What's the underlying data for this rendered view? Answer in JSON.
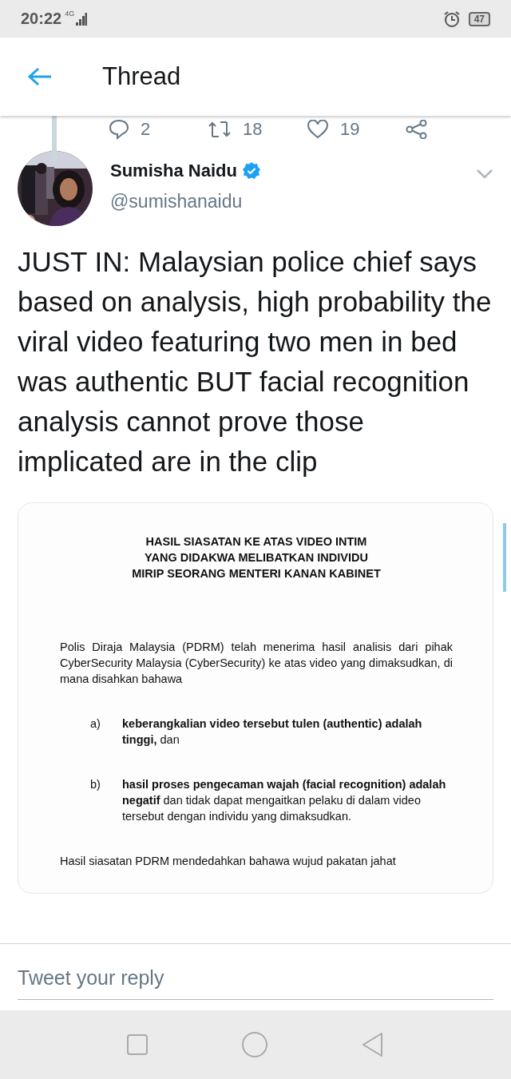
{
  "status_bar": {
    "time": "20:22",
    "network": "4G",
    "battery": "47"
  },
  "header": {
    "title": "Thread"
  },
  "previous_tweet_actions": {
    "replies": "2",
    "retweets": "18",
    "likes": "19"
  },
  "tweet": {
    "name": "Sumisha Naidu",
    "verified": true,
    "handle": "@sumishanaidu",
    "text": "JUST IN: Malaysian police chief says based on analysis, high probability the viral video featuring two men in bed was authentic BUT facial recognition analysis cannot prove those implicated are in the clip",
    "document": {
      "title_lines": [
        "HASIL SIASATAN KE ATAS VIDEO INTIM",
        "YANG DIDAKWA MELIBATKAN  INDIVIDU",
        "MIRIP SEORANG MENTERI KANAN KABINET"
      ],
      "intro": "Polis Diraja Malaysia (PDRM) telah menerima hasil analisis dari pihak CyberSecurity Malaysia (CyberSecurity) ke atas video yang dimaksudkan,  di mana disahkan bahawa",
      "items": [
        {
          "marker": "a)",
          "text": "**keberangkalian video tersebut tulen (authentic) adalah tinggi,** dan"
        },
        {
          "marker": "b)",
          "text": "**hasil proses pengecaman wajah (facial recognition) adalah negatif** dan tidak dapat  mengaitkan pelaku di dalam video tersebut dengan individu yang dimaksudkan."
        }
      ],
      "closing": "Hasil siasatan PDRM mendedahkan bahawa wujud pakatan jahat"
    }
  },
  "reply": {
    "placeholder": "Tweet your reply"
  }
}
